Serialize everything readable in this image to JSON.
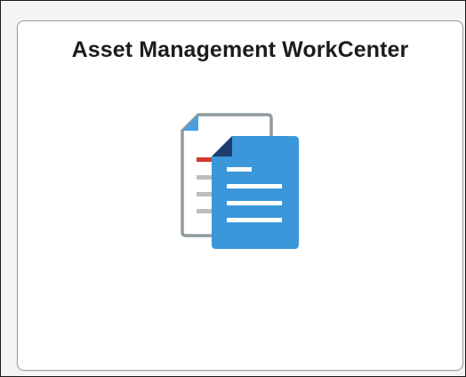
{
  "tile": {
    "title": "Asset Management WorkCenter",
    "icon": "documents-icon"
  },
  "colors": {
    "front_doc": "#3a97d9",
    "front_doc_fold": "#1e3c6e",
    "back_doc_border": "#8f9b9f",
    "back_doc_corner": "#4a9fe0",
    "back_doc_red_line": "#d23a2e",
    "back_doc_gray_line": "#b9bec1",
    "lines_white": "#ffffff"
  }
}
